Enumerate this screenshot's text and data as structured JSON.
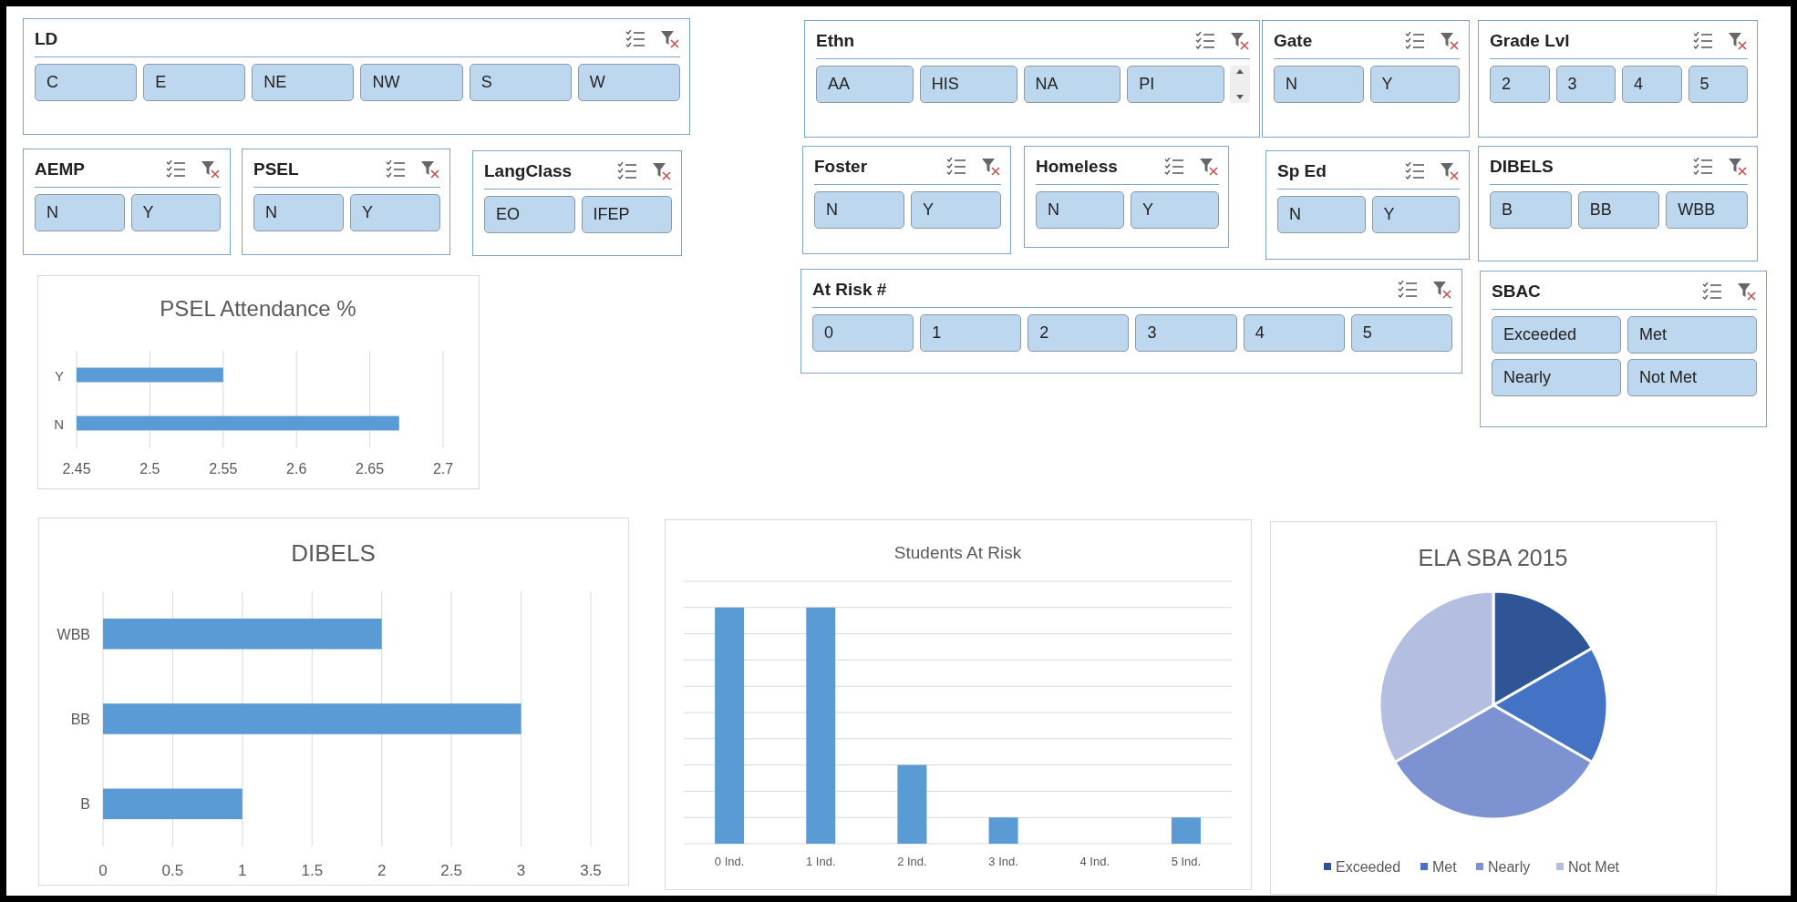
{
  "slicers": [
    {
      "title": "LD",
      "items": [
        {
          "label": "C",
          "selected": true
        },
        {
          "label": "E",
          "selected": true
        },
        {
          "label": "NE",
          "selected": true
        },
        {
          "label": "NW",
          "selected": true
        },
        {
          "label": "S",
          "selected": true
        },
        {
          "label": "W",
          "selected": true
        }
      ]
    },
    {
      "title": "AEMP",
      "items": [
        {
          "label": "N",
          "selected": true
        },
        {
          "label": "Y",
          "selected": true
        }
      ]
    },
    {
      "title": "PSEL",
      "items": [
        {
          "label": "N",
          "selected": true
        },
        {
          "label": "Y",
          "selected": true
        }
      ]
    },
    {
      "title": "LangClass",
      "items": [
        {
          "label": "EO",
          "selected": true
        },
        {
          "label": "IFEP",
          "selected": true
        }
      ]
    },
    {
      "title": "Ethn",
      "scrollbar": true,
      "items": [
        {
          "label": "AA",
          "selected": true
        },
        {
          "label": "HIS",
          "selected": true
        },
        {
          "label": "NA",
          "selected": true
        },
        {
          "label": "PI",
          "selected": true
        }
      ]
    },
    {
      "title": "Gate",
      "items": [
        {
          "label": "N",
          "selected": true
        },
        {
          "label": "Y",
          "selected": true
        }
      ]
    },
    {
      "title": "Grade Lvl",
      "items": [
        {
          "label": "2",
          "selected": true
        },
        {
          "label": "3",
          "selected": true
        },
        {
          "label": "4",
          "selected": true
        },
        {
          "label": "5",
          "selected": true
        }
      ]
    },
    {
      "title": "Foster",
      "items": [
        {
          "label": "N",
          "selected": true
        },
        {
          "label": "Y",
          "selected": true
        }
      ]
    },
    {
      "title": "Homeless",
      "items": [
        {
          "label": "N",
          "selected": true
        },
        {
          "label": "Y",
          "selected": true
        }
      ]
    },
    {
      "title": "Sp Ed",
      "items": [
        {
          "label": "N",
          "selected": true
        },
        {
          "label": "Y",
          "selected": true
        }
      ]
    },
    {
      "title": "DIBELS",
      "items": [
        {
          "label": "B",
          "selected": true
        },
        {
          "label": "BB",
          "selected": true
        },
        {
          "label": "WBB",
          "selected": true
        }
      ]
    },
    {
      "title": "At Risk #",
      "items": [
        {
          "label": "0",
          "selected": true
        },
        {
          "label": "1",
          "selected": true
        },
        {
          "label": "2",
          "selected": true
        },
        {
          "label": "3",
          "selected": true
        },
        {
          "label": "4",
          "selected": true
        },
        {
          "label": "5",
          "selected": true
        }
      ]
    },
    {
      "title": "SBAC",
      "items": [
        {
          "label": "Exceeded",
          "selected": true
        },
        {
          "label": "Met",
          "selected": true
        },
        {
          "label": "Nearly",
          "selected": true
        },
        {
          "label": "Not Met",
          "selected": true
        }
      ]
    }
  ],
  "charts": [
    {
      "kind": "bar",
      "chart_data": {
        "type": "bar",
        "orientation": "horizontal",
        "title": "PSEL Attendance %",
        "grid": true,
        "categories": [
          "Y",
          "N"
        ],
        "values": [
          2.55,
          2.67
        ],
        "xlim": [
          2.45,
          2.7
        ],
        "xticks": [
          {
            "value": 2.45,
            "label": "2.45"
          },
          {
            "value": 2.5,
            "label": "2.5"
          },
          {
            "value": 2.55,
            "label": "2.55"
          },
          {
            "value": 2.6,
            "label": "2.6"
          },
          {
            "value": 2.65,
            "label": "2.65"
          },
          {
            "value": 2.7,
            "label": "2.7"
          }
        ]
      }
    },
    {
      "kind": "bar",
      "chart_data": {
        "type": "bar",
        "orientation": "horizontal",
        "title": "DIBELS",
        "grid": true,
        "categories": [
          "WBB",
          "BB",
          "B"
        ],
        "values": [
          2,
          3,
          1
        ],
        "xlim": [
          0,
          3.5
        ],
        "xticks": [
          {
            "value": 0,
            "label": "0"
          },
          {
            "value": 0.5,
            "label": "0.5"
          },
          {
            "value": 1,
            "label": "1"
          },
          {
            "value": 1.5,
            "label": "1.5"
          },
          {
            "value": 2,
            "label": "2"
          },
          {
            "value": 2.5,
            "label": "2.5"
          },
          {
            "value": 3,
            "label": "3"
          },
          {
            "value": 3.5,
            "label": "3.5"
          }
        ]
      }
    },
    {
      "kind": "columns",
      "title": "Students At Risk",
      "categories": [
        "0 Ind.",
        "1 Ind.",
        "2 Ind.",
        "3 Ind.",
        "4 Ind.",
        "5 Ind."
      ]
    },
    {
      "kind": "pie",
      "title": "ELA SBA 2015",
      "legend": [
        {
          "label": "Exceeded",
          "color": "#2f5597"
        },
        {
          "label": "Met",
          "color": "#4472c4"
        },
        {
          "label": "Nearly",
          "color": "#7c92d1"
        },
        {
          "label": "Not Met",
          "color": "#b4bee0"
        }
      ]
    }
  ]
}
